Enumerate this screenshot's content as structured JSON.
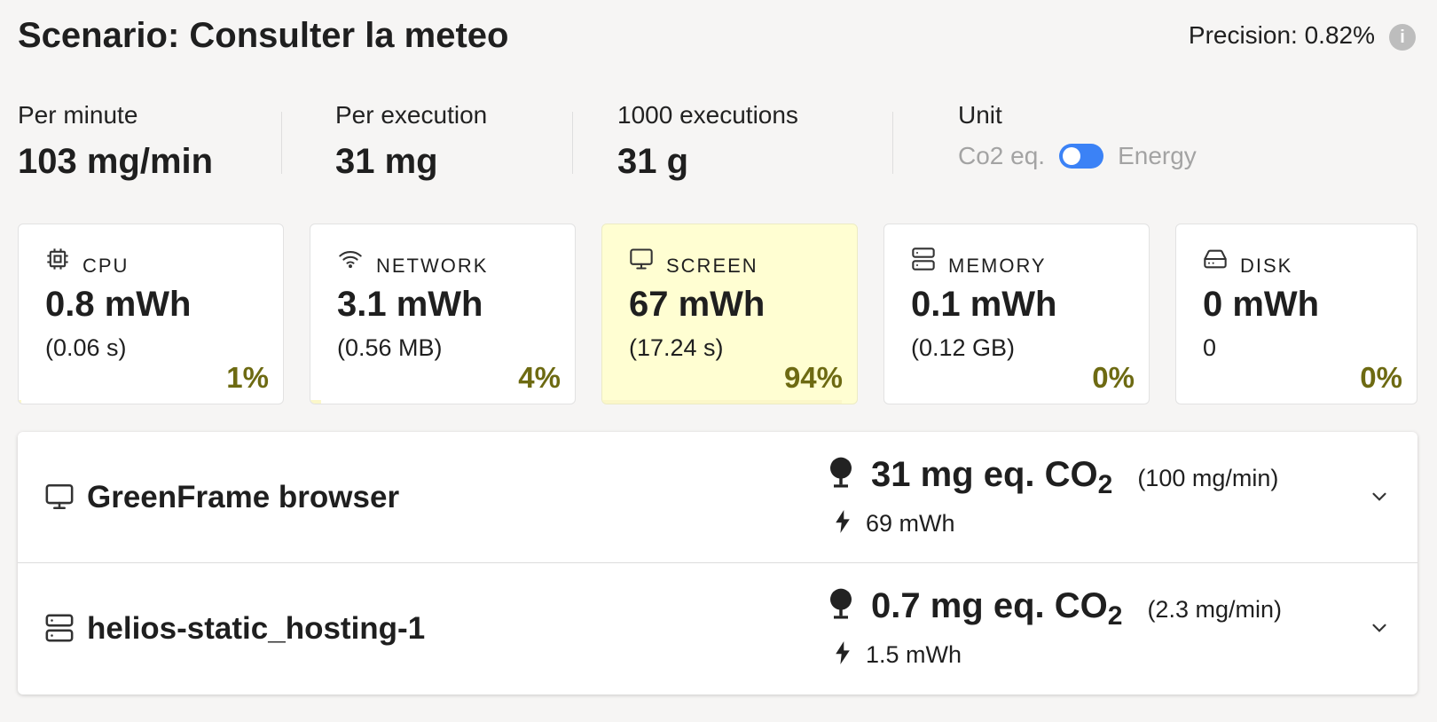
{
  "header": {
    "title": "Scenario: Consulter la meteo",
    "precision": "Precision: 0.82%",
    "info_icon": "info-icon"
  },
  "stats": {
    "per_minute": {
      "label": "Per minute",
      "value": "103 mg/min"
    },
    "per_execution": {
      "label": "Per execution",
      "value": "31 mg"
    },
    "thousand": {
      "label": "1000 executions",
      "value": "31 g"
    },
    "unit": {
      "label": "Unit",
      "left": "Co2 eq.",
      "right": "Energy",
      "toggle_on": true
    }
  },
  "cards": [
    {
      "icon": "cpu-icon",
      "label": "CPU",
      "value": "0.8 mWh",
      "detail": "(0.06 s)",
      "percent": "1%",
      "share": 0.01,
      "highlight": false
    },
    {
      "icon": "wifi-icon",
      "label": "NETWORK",
      "value": "3.1 mWh",
      "detail": "(0.56 MB)",
      "percent": "4%",
      "share": 0.04,
      "highlight": false
    },
    {
      "icon": "monitor-icon",
      "label": "SCREEN",
      "value": "67 mWh",
      "detail": "(17.24 s)",
      "percent": "94%",
      "share": 0.94,
      "highlight": true
    },
    {
      "icon": "server-icon",
      "label": "MEMORY",
      "value": "0.1 mWh",
      "detail": "(0.12 GB)",
      "percent": "0%",
      "share": 0.0,
      "highlight": false
    },
    {
      "icon": "harddrive-icon",
      "label": "DISK",
      "value": "0 mWh",
      "detail": "0",
      "percent": "0%",
      "share": 0.0,
      "highlight": false
    }
  ],
  "containers": [
    {
      "icon": "monitor-icon",
      "name": "GreenFrame browser",
      "co2": "31 mg eq. CO",
      "co2_sub": "2",
      "rate": "(100 mg/min)",
      "energy": "69 mWh"
    },
    {
      "icon": "server-icon",
      "name": "helios-static_hosting-1",
      "co2": "0.7 mg eq. CO",
      "co2_sub": "2",
      "rate": "(2.3 mg/min)",
      "energy": "1.5 mWh"
    }
  ],
  "colors": {
    "accent": "#3b82f6",
    "highlight": "#fffed2",
    "percent": "#6d6a12"
  }
}
